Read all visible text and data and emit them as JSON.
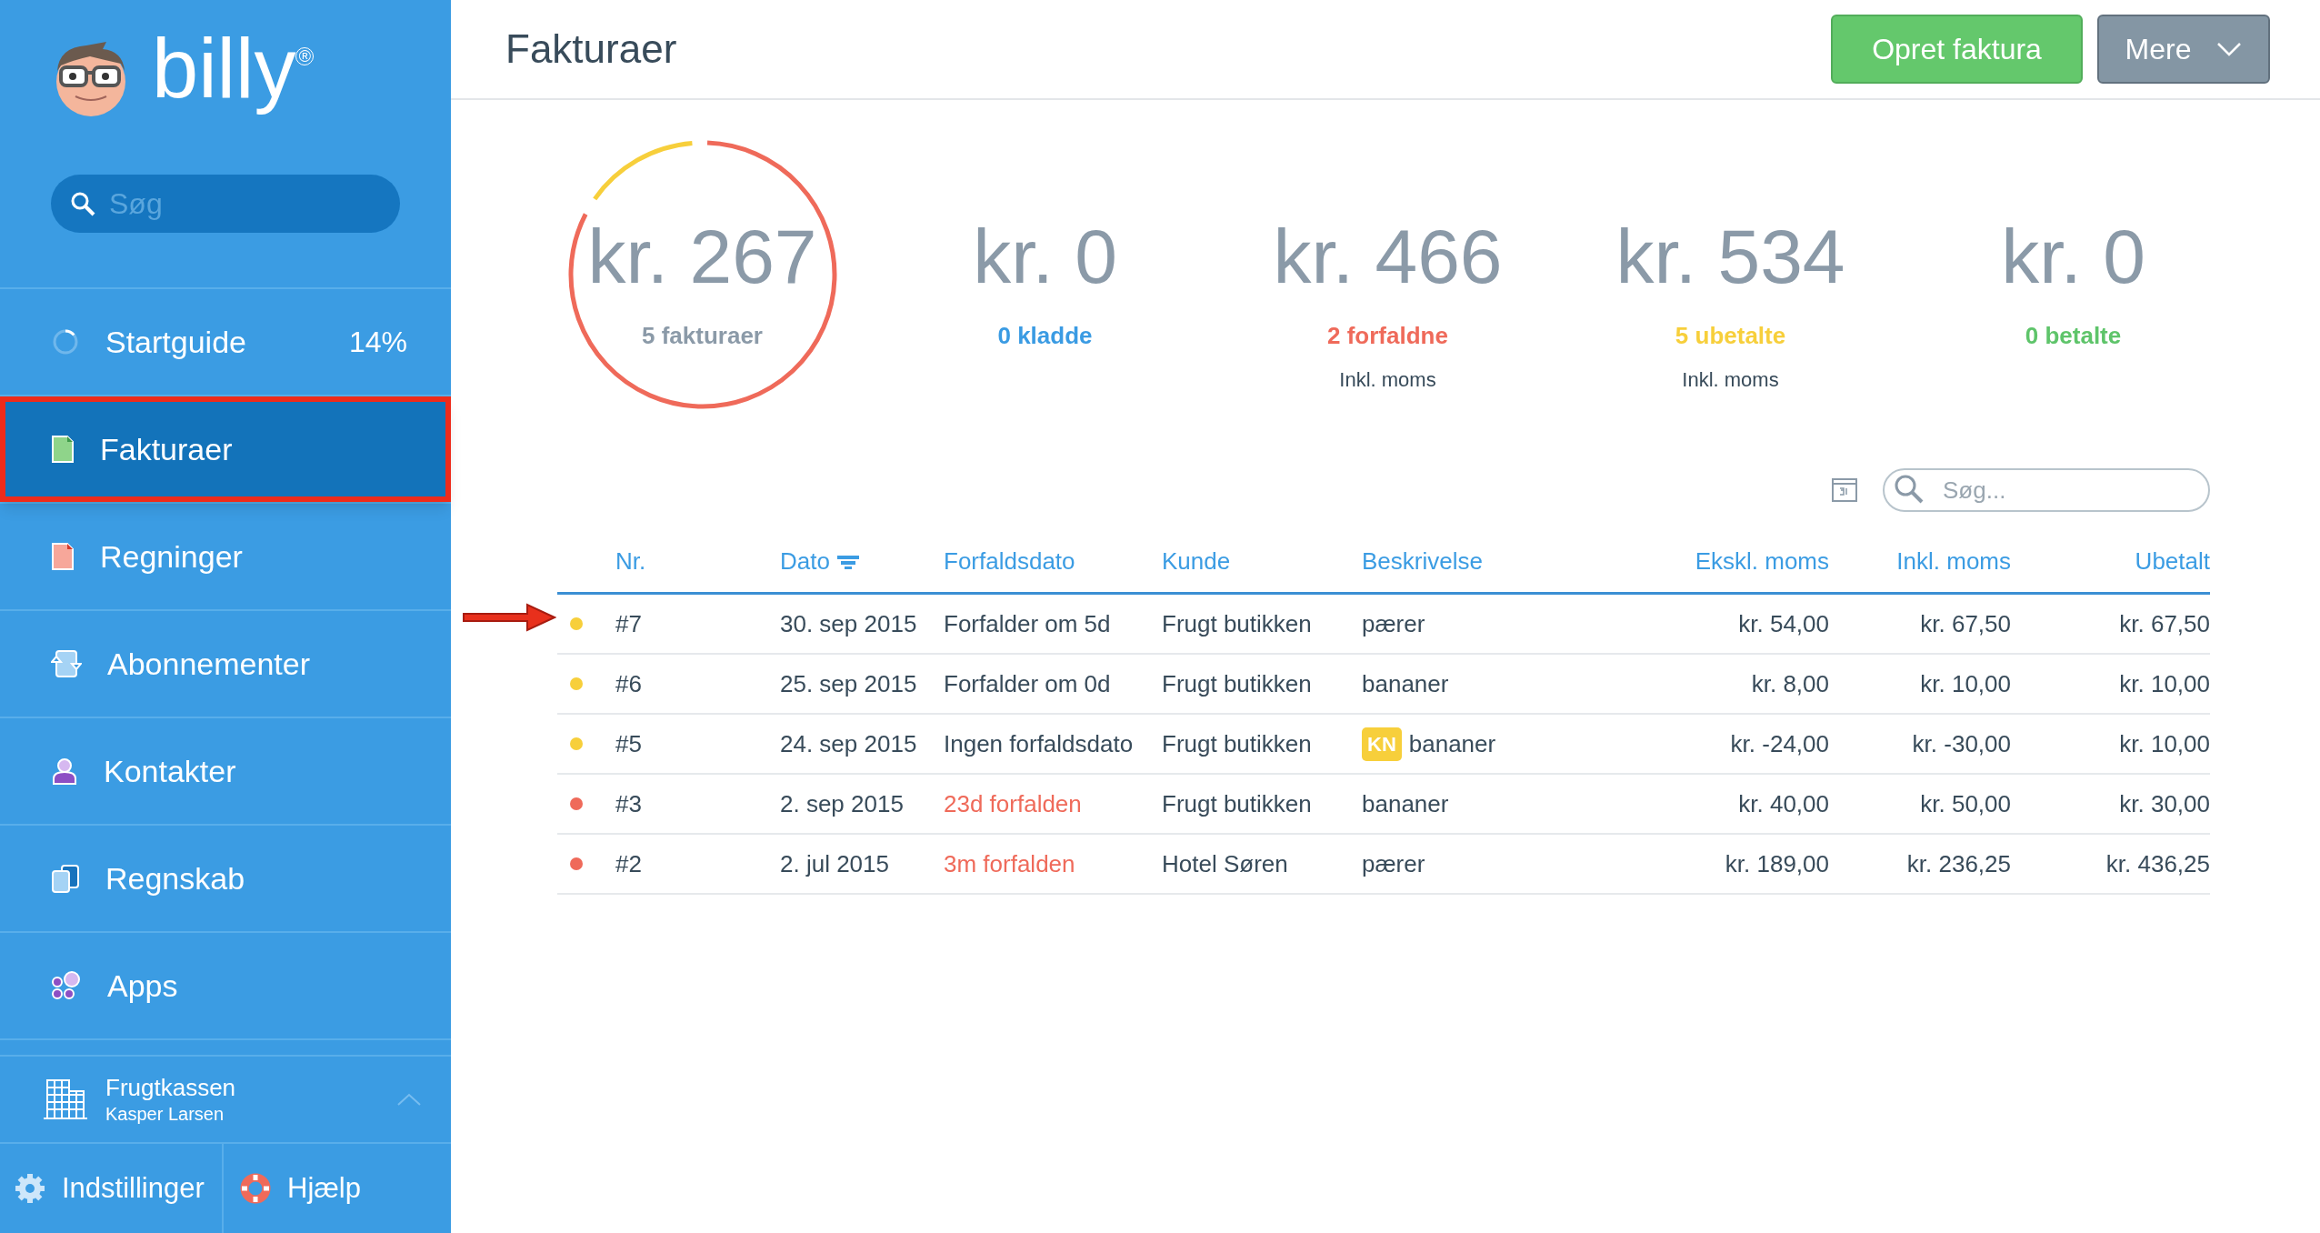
{
  "sidebar": {
    "logo": {
      "text": "billy",
      "mark": "®"
    },
    "search": {
      "placeholder": "Søg"
    },
    "items": [
      {
        "label": "Startguide",
        "value": "14%",
        "level": 0.14,
        "selected": false,
        "annotated": false
      },
      {
        "label": "Fakturaer",
        "selected": true,
        "annotated": true
      },
      {
        "label": "Regninger",
        "selected": false,
        "annotated": false
      },
      {
        "label": "Abonnementer",
        "selected": false,
        "annotated": false
      },
      {
        "label": "Kontakter",
        "selected": false,
        "annotated": false
      },
      {
        "label": "Regnskab",
        "selected": false,
        "annotated": false
      },
      {
        "label": "Apps",
        "selected": false,
        "annotated": false
      }
    ],
    "account": {
      "company": "Frugtkassen",
      "user": "Kasper Larsen"
    },
    "footer": [
      "Indstillinger",
      "Hjælp"
    ]
  },
  "header": {
    "title": "Fakturaer",
    "buttons": [
      {
        "label": "Opret faktura",
        "kind": "primary"
      },
      {
        "label": "Mere",
        "kind": "dropdown"
      }
    ]
  },
  "summary": [
    {
      "amount": "kr. 267",
      "label": "5 fakturaer",
      "color": "#8b9aa8",
      "kind": "ring"
    },
    {
      "amount": "kr. 0",
      "label": "0 kladde",
      "color": "#3a9be3",
      "kind": "plain"
    },
    {
      "amount": "kr. 466",
      "label": "2 forfaldne",
      "color": "#ef6a5a",
      "kind": "plain",
      "note": "Inkl. moms"
    },
    {
      "amount": "kr. 534",
      "label": "5 ubetalte",
      "color": "#f7cf3b",
      "kind": "plain",
      "note": "Inkl. moms"
    },
    {
      "amount": "kr. 0",
      "label": "0 betalte",
      "color": "#5ec46a",
      "kind": "plain"
    }
  ],
  "table": {
    "search": {
      "placeholder": "Søg..."
    },
    "columns": [
      {
        "label": "Nr.",
        "sorted": false
      },
      {
        "label": "Dato",
        "sorted": true
      },
      {
        "label": "Forfaldsdato",
        "sorted": false
      },
      {
        "label": "Kunde",
        "sorted": false
      },
      {
        "label": "Beskrivelse",
        "sorted": false
      },
      {
        "label": "Ekskl. moms",
        "sorted": false
      },
      {
        "label": "Inkl. moms",
        "sorted": false
      },
      {
        "label": "Ubetalt",
        "sorted": false
      }
    ],
    "rows": [
      {
        "color": "#f7cf3b",
        "annotated": true,
        "overdue": false,
        "cells": [
          "#7",
          "30. sep 2015",
          "Forfalder om 5d",
          "Frugt butikken",
          "pærer",
          "kr. 54,00",
          "kr. 67,50",
          "kr. 67,50"
        ]
      },
      {
        "color": "#f7cf3b",
        "annotated": false,
        "overdue": false,
        "cells": [
          "#6",
          "25. sep 2015",
          "Forfalder om 0d",
          "Frugt butikken",
          "bananer",
          "kr. 8,00",
          "kr. 10,00",
          "kr. 10,00"
        ]
      },
      {
        "color": "#f7cf3b",
        "annotated": false,
        "overdue": false,
        "tag": "KN",
        "cells": [
          "#5",
          "24. sep 2015",
          "Ingen forfaldsdato",
          "Frugt butikken",
          "bananer",
          "kr. -24,00",
          "kr. -30,00",
          "kr. 10,00"
        ]
      },
      {
        "color": "#ef6a5a",
        "annotated": false,
        "overdue": true,
        "cells": [
          "#3",
          "2. sep 2015",
          "23d forfalden",
          "Frugt butikken",
          "bananer",
          "kr. 40,00",
          "kr. 50,00",
          "kr. 30,00"
        ]
      },
      {
        "color": "#ef6a5a",
        "annotated": false,
        "overdue": true,
        "cells": [
          "#2",
          "2. jul 2015",
          "3m forfalden",
          "Hotel Søren",
          "pærer",
          "kr. 189,00",
          "kr. 236,25",
          "kr. 436,25"
        ]
      }
    ]
  }
}
